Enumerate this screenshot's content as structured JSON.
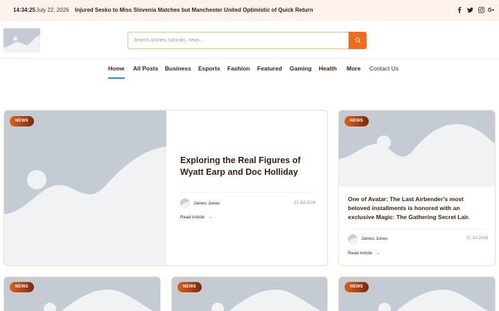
{
  "topbar": {
    "time": "14:34:25",
    "date": "July 22, 2026",
    "ticker": "Injured Sesko to Miss Slovenia Matches but Manchester United Optimistic of Quick Return",
    "social_icons": [
      "facebook-icon",
      "twitter-icon",
      "instagram-icon",
      "google-plus-icon"
    ]
  },
  "search": {
    "placeholder": "Search articles, tutorials, news..."
  },
  "nav": {
    "items": [
      "Home",
      "All Posts",
      "Business",
      "Esports",
      "Fashion",
      "Featured",
      "Gaming",
      "Health",
      "More",
      "Contact Us"
    ],
    "active": "Home"
  },
  "featured": {
    "badge": "NEWS",
    "title": "Exploring the Real Figures of Wyatt Earp and Doc Holliday",
    "author": "James Jones",
    "date": "21 Jul 2026",
    "read_more": "Read Article"
  },
  "side_post": {
    "badge": "NEWS",
    "title": "One of Avatar: The Last Airbender's most beloved installments is honored with an exclusive Magic: The Gathering Secret Lair.",
    "author": "James Jones",
    "date": "21 Jul 2026",
    "read_more": "Read Article"
  },
  "bottom_cards": [
    {
      "badge": "NEWS"
    },
    {
      "badge": "NEWS"
    },
    {
      "badge": "NEWS"
    }
  ],
  "colors": {
    "accent": "#f26b1d",
    "topbar_bg": "#fdf3ec",
    "text_dark": "#3a1d10",
    "active_underline": "#2e86de",
    "placeholder_gray": "#c4cbd3"
  }
}
